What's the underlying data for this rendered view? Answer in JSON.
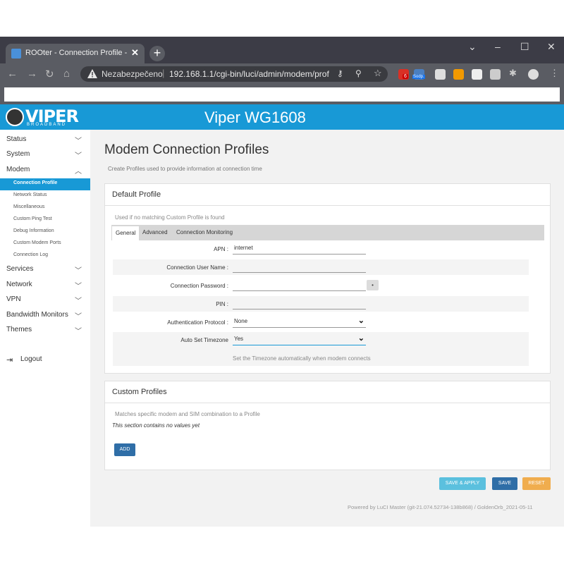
{
  "browser": {
    "tab_title": "ROOter - Connection Profile - LuCI",
    "tab_close": "✕",
    "new_tab": "+",
    "insecure_label": "Nezabezpečeno",
    "url_separator": "|",
    "url": "192.168.1.1/cgi-bin/luci/admin/modem/prof",
    "gmail_badge": "6",
    "sodp_badge": "Sodp."
  },
  "header": {
    "logo_text": "VIPER",
    "logo_sub": "BROADBAND",
    "site_title": "Viper WG1608",
    "brand_color": "#1899d6"
  },
  "sidebar": {
    "items": [
      {
        "label": "Status"
      },
      {
        "label": "System"
      },
      {
        "label": "Modem"
      },
      {
        "label": "Services"
      },
      {
        "label": "Network"
      },
      {
        "label": "VPN"
      },
      {
        "label": "Bandwidth Monitors"
      },
      {
        "label": "Themes"
      }
    ],
    "modem_subitems": [
      {
        "label": "Connection Profile",
        "active": true
      },
      {
        "label": "Network Status"
      },
      {
        "label": "Miscellaneous"
      },
      {
        "label": "Custom Ping Test"
      },
      {
        "label": "Debug Information"
      },
      {
        "label": "Custom Modem Ports"
      },
      {
        "label": "Connection Log"
      }
    ],
    "logout_label": "Logout"
  },
  "main": {
    "title": "Modem Connection Profiles",
    "description": "Create Profiles used to provide information at connection time",
    "default_profile": {
      "title": "Default Profile",
      "description": "Used if no matching Custom Profile is found",
      "tabs": [
        "General",
        "Advanced",
        "Connection Monitoring"
      ],
      "fields": {
        "apn": {
          "label": "APN :",
          "value": "internet"
        },
        "user": {
          "label": "Connection User Name :",
          "value": ""
        },
        "password": {
          "label": "Connection Password :",
          "value": ""
        },
        "pin": {
          "label": "PIN :",
          "value": ""
        },
        "auth": {
          "label": "Authentication Protocol :",
          "value": "None"
        },
        "timezone": {
          "label": "Auto Set Timezone",
          "value": "Yes"
        }
      },
      "timezone_help": "Set the Timezone automatically when modem connects"
    },
    "custom_profiles": {
      "title": "Custom Profiles",
      "description": "Matches specific modem and SIM combination to a Profile",
      "empty_note": "This section contains no values yet",
      "add_label": "ADD"
    },
    "actions": {
      "save_apply": "SAVE & APPLY",
      "save": "SAVE",
      "reset": "RESET"
    },
    "footer": "Powered by LuCI Master (git-21.074.52734-138b868) / GoldenOrb_2021-05-11"
  }
}
